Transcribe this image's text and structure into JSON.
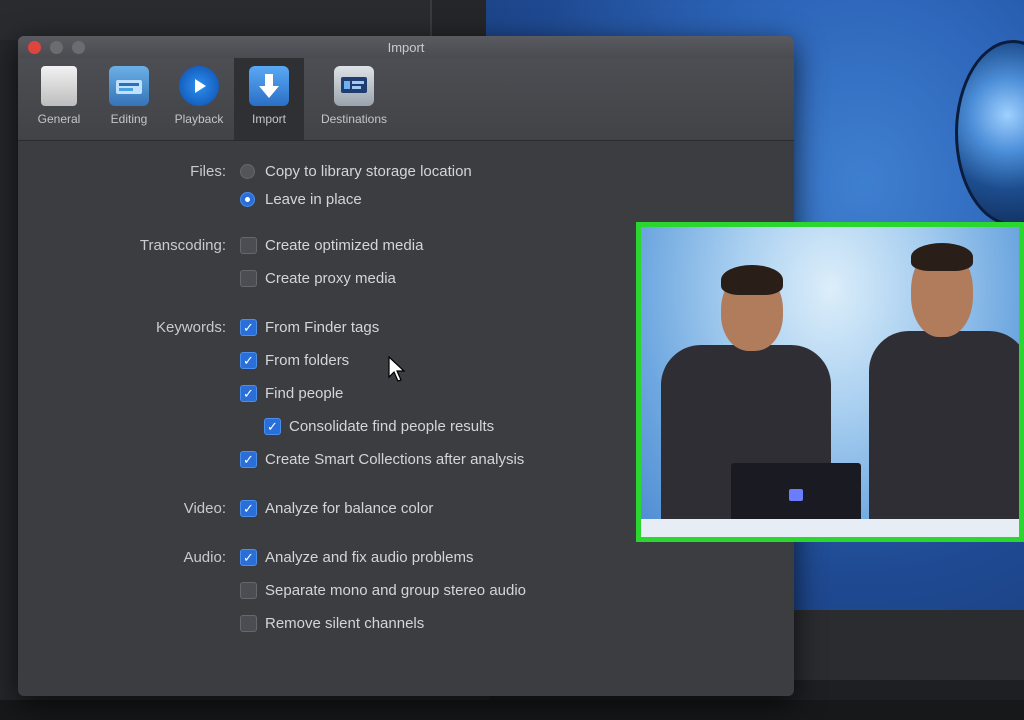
{
  "window": {
    "title": "Import"
  },
  "toolbar": {
    "items": [
      {
        "label": "General",
        "icon": "general-icon"
      },
      {
        "label": "Editing",
        "icon": "editing-icon"
      },
      {
        "label": "Playback",
        "icon": "playback-icon"
      },
      {
        "label": "Import",
        "icon": "import-icon",
        "selected": true
      },
      {
        "label": "Destinations",
        "icon": "destinations-icon"
      }
    ]
  },
  "files": {
    "label": "Files:",
    "options": [
      {
        "label": "Copy to library storage location",
        "selected": false
      },
      {
        "label": "Leave in place",
        "selected": true
      }
    ]
  },
  "transcoding": {
    "label": "Transcoding:",
    "options": [
      {
        "label": "Create optimized media",
        "checked": false
      },
      {
        "label": "Create proxy media",
        "checked": false
      }
    ]
  },
  "keywords": {
    "label": "Keywords:",
    "options": [
      {
        "label": "From Finder tags",
        "checked": true
      },
      {
        "label": "From folders",
        "checked": true
      },
      {
        "label": "Find people",
        "checked": true
      },
      {
        "label": "Consolidate find people results",
        "checked": true
      },
      {
        "label": "Create Smart Collections after analysis",
        "checked": true
      }
    ]
  },
  "video": {
    "label": "Video:",
    "options": [
      {
        "label": "Analyze for balance color",
        "checked": true
      }
    ]
  },
  "audio": {
    "label": "Audio:",
    "options": [
      {
        "label": "Analyze and fix audio problems",
        "checked": true
      },
      {
        "label": "Separate mono and group stereo audio",
        "checked": false
      },
      {
        "label": "Remove silent channels",
        "checked": false
      }
    ]
  },
  "colors": {
    "accent": "#2a6fd8",
    "pip_border": "#2bd62e",
    "close_button": "#e0443e"
  }
}
